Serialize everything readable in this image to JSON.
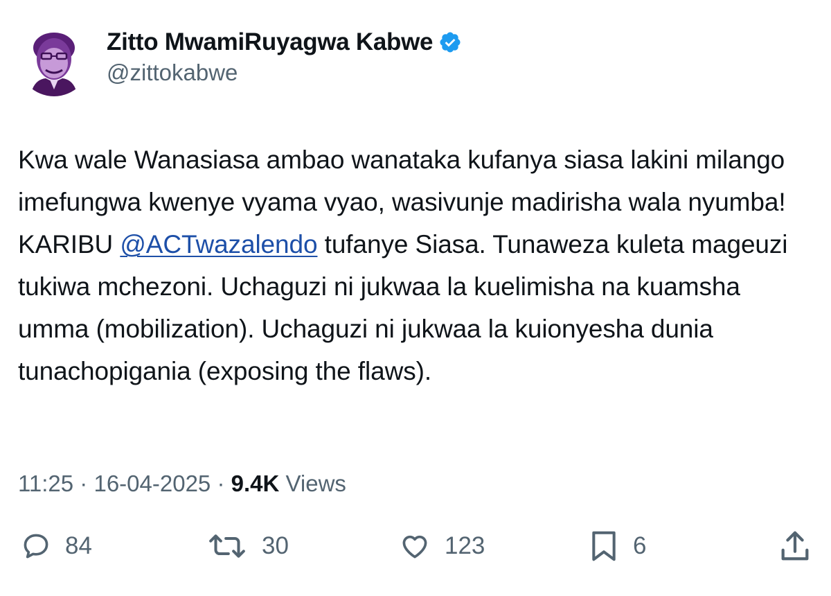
{
  "author": {
    "display_name": "Zitto MwamiRuyagwa Kabwe",
    "handle": "@zittokabwe",
    "verified": true
  },
  "tweet": {
    "text_part1": "Kwa wale Wanasiasa ambao wanataka kufanya siasa lakini milango imefungwa kwenye vyama vyao, wasivunje madirisha wala nyumba! KARIBU ",
    "mention": "@ACTwazalendo",
    "text_part2": " tufanye Siasa. Tunaweza kuleta mageuzi tukiwa mchezoni. Uchaguzi ni jukwaa la kuelimisha na kuamsha umma (mobilization). Uchaguzi ni jukwaa la kuionyesha dunia tunachopigania (exposing the flaws)."
  },
  "meta": {
    "time": "11:25",
    "separator": " · ",
    "date": "16-04-2025",
    "views_count": "9.4K",
    "views_label": " Views"
  },
  "actions": {
    "replies": "84",
    "reposts": "30",
    "likes": "123",
    "bookmarks": "6"
  },
  "colors": {
    "text": "#0f1419",
    "secondary": "#536471",
    "link": "#1d4fa8",
    "verified_badge": "#1d9bf0",
    "avatar_tint": "#6b2a8c"
  },
  "icons": {
    "verified": "verified-badge-icon",
    "reply": "reply-icon",
    "repost": "repost-icon",
    "like": "heart-icon",
    "bookmark": "bookmark-icon",
    "share": "share-icon"
  }
}
